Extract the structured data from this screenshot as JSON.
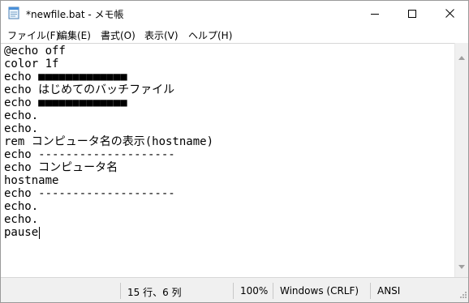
{
  "window": {
    "title": "*newfile.bat - メモ帳"
  },
  "menu": {
    "items": [
      {
        "label": "ファイル(F)"
      },
      {
        "label": "編集(E)"
      },
      {
        "label": "書式(O)"
      },
      {
        "label": "表示(V)"
      },
      {
        "label": "ヘルプ(H)"
      }
    ]
  },
  "editor": {
    "lines": [
      "@echo off",
      "color 1f",
      "echo ■■■■■■■■■■■■■",
      "echo はじめてのバッチファイル",
      "echo ■■■■■■■■■■■■■",
      "echo.",
      "echo.",
      "rem コンピュータ名の表示(hostname)",
      "echo --------------------",
      "echo コンピュータ名",
      "hostname",
      "echo --------------------",
      "echo.",
      "echo.",
      "pause"
    ]
  },
  "status": {
    "position": "15 行、6 列",
    "zoom": "100%",
    "line_ending": "Windows (CRLF)",
    "encoding": "ANSI"
  },
  "icons": {
    "app": "notepad-icon",
    "minimize": "minimize-icon",
    "maximize": "maximize-icon",
    "close": "close-icon"
  }
}
